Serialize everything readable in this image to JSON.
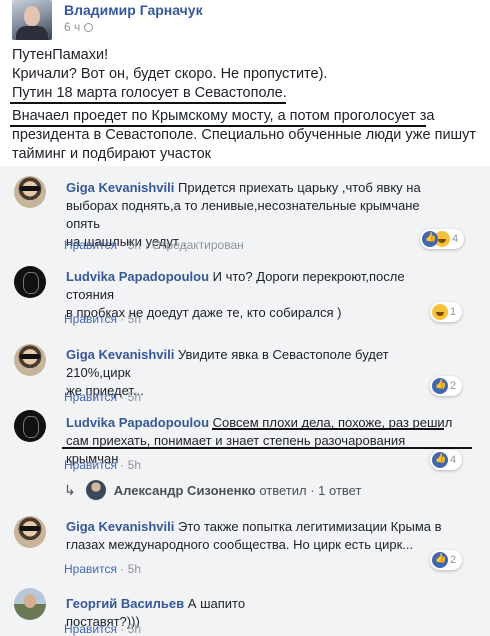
{
  "post": {
    "author": "Владимир Гарначук",
    "time": "6 ч",
    "lines": [
      "ПутенПамахи!",
      "Кричали? Вот он, будет скоро. Не пропустите).",
      "Путин 18 марта голосует в Севастополе.",
      "Вначаел проедет по Крымскому мосту, а потом проголосует за",
      "президента в Севастополе. Специально обученные люди уже пишут",
      "тайминг и подбирают участок"
    ]
  },
  "comments": [
    {
      "author": "Giga Kevanishvili",
      "lines": [
        "Придется приехать царьку ,чтоб явку на",
        "выборах поднять,а то ленивые,несознательные крымчане опять",
        "на шашлыки уедут ."
      ],
      "like": "Нравится",
      "time": "5h",
      "edited": "Отредактирован",
      "reactions": "4"
    },
    {
      "author": "Ludvika Papadopoulou",
      "lines": [
        "И что? Дороги перекроют,после стояния",
        "в пробках не доедут даже те, кто собирался )"
      ],
      "like": "Нравится",
      "time": "5h",
      "reactions": "1"
    },
    {
      "author": "Giga Kevanishvili",
      "lines": [
        "Увидите явка в Севастополе будет 210%,цирк",
        "же приедет..."
      ],
      "like": "Нравится",
      "time": "5h",
      "reactions": "2"
    },
    {
      "author": "Ludvika Papadopoulou",
      "lines": [
        "Совсем плохи дела, похоже, раз решил",
        "сам приехать, понимает и знает степень разочарования крымчан"
      ],
      "like": "Нравится",
      "time": "5h",
      "reactions": "4"
    },
    {
      "author": "Giga Kevanishvili",
      "lines": [
        "Это также попытка легитимизации Крыма в",
        "глазах международного сообщества. Но цирк есть цирк..."
      ],
      "like": "Нравится",
      "time": "5h",
      "reactions": "2"
    },
    {
      "author": "Георгий Васильев",
      "lines": [
        "А шапито поставят?)))"
      ],
      "like": "Нравится",
      "time": "5h"
    }
  ],
  "reply": {
    "author": "Александр Сизоненко",
    "text": "ответил · 1 ответ"
  },
  "sep": "·",
  "colors": {
    "link": "#365899",
    "bubble": "#f2f3f5",
    "like_blue": "#4267b2"
  }
}
